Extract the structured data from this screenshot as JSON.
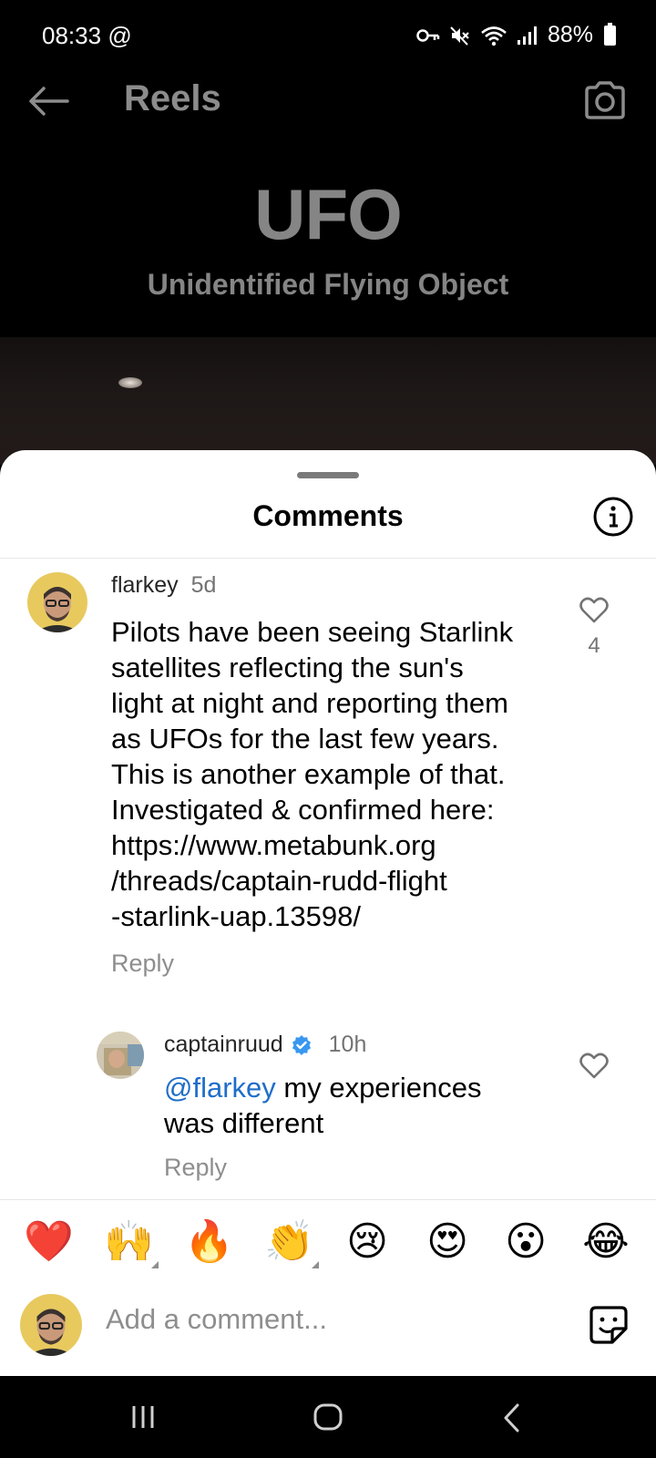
{
  "status_bar": {
    "time": "08:33",
    "at_symbol": "@",
    "battery": "88%",
    "icons": [
      "key-icon",
      "mute-icon",
      "wifi-icon",
      "signal-icon",
      "battery-icon"
    ]
  },
  "header": {
    "title": "Reels",
    "back_icon": "back-arrow-icon",
    "camera_icon": "camera-icon"
  },
  "video": {
    "title": "UFO",
    "subtitle": "Unidentified Flying Object"
  },
  "comments_sheet": {
    "title": "Comments",
    "info_icon": "info-icon",
    "comments": [
      {
        "username": "flarkey",
        "time": "5d",
        "text": "Pilots have been seeing Starlink satellites reflecting the sun's light at night and reporting them as UFOs for the last few years. This is another example of that. Investigated & confirmed here: https://www.metabunk.org/threads/captain-rudd-flight-starlink-uap.13598/",
        "text_lines": [
          "Pilots have been seeing Starlink",
          "satellites reflecting the sun's",
          "light at night and reporting them",
          "as UFOs for the last few years.",
          "This is another example of that.",
          "Investigated & confirmed here:",
          "https://www.metabunk.org",
          "/threads/captain-rudd-flight",
          "-starlink-uap.13598/"
        ],
        "reply_label": "Reply",
        "likes": "4"
      },
      {
        "username": "captainruud",
        "verified": true,
        "time": "10h",
        "mention": "@flarkey",
        "text": " my experiences",
        "text_line2": "was different",
        "reply_label": "Reply"
      }
    ]
  },
  "emoji_bar": [
    "❤️",
    "🙌",
    "🔥",
    "👏",
    "😢",
    "😍",
    "😮",
    "😂"
  ],
  "composer": {
    "placeholder": "Add a comment...",
    "sticker_icon": "sticker-icon"
  },
  "nav_bar": [
    "recent-apps-icon",
    "home-icon",
    "back-icon"
  ],
  "colors": {
    "mention": "#1e6ec8",
    "verified": "#3897f0",
    "sheet_bg": "#ffffff",
    "heart_emoji": "#ff3040"
  }
}
